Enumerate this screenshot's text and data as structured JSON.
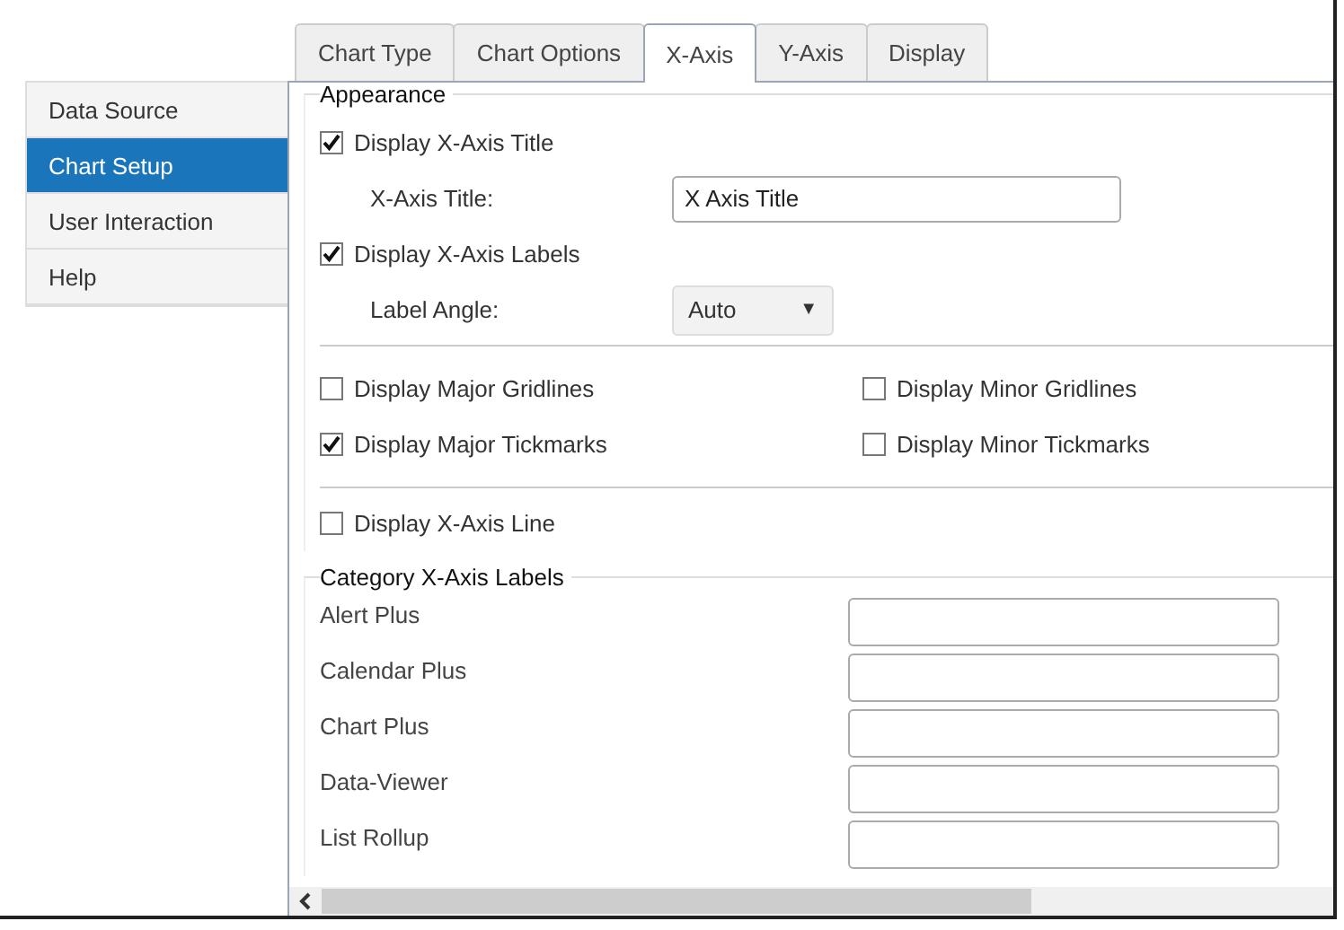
{
  "tabs": [
    {
      "label": "Chart Type",
      "selected": false
    },
    {
      "label": "Chart Options",
      "selected": false
    },
    {
      "label": "X-Axis",
      "selected": true
    },
    {
      "label": "Y-Axis",
      "selected": false
    },
    {
      "label": "Display",
      "selected": false
    }
  ],
  "sidebar": {
    "items": [
      {
        "label": "Data Source",
        "selected": false
      },
      {
        "label": "Chart Setup",
        "selected": true
      },
      {
        "label": "User Interaction",
        "selected": false
      },
      {
        "label": "Help",
        "selected": false
      }
    ]
  },
  "appearance": {
    "legend": "Appearance",
    "display_title": {
      "label": "Display X-Axis Title",
      "checked": true
    },
    "title_field": {
      "label": "X-Axis Title:",
      "value": "X Axis Title"
    },
    "display_labels": {
      "label": "Display X-Axis Labels",
      "checked": true
    },
    "label_angle": {
      "label": "Label Angle:",
      "value": "Auto",
      "caret": "▼"
    },
    "gridlines": [
      {
        "label": "Display Major Gridlines",
        "checked": false
      },
      {
        "label": "Display Minor Gridlines",
        "checked": false
      },
      {
        "label": "Display Major Tickmarks",
        "checked": true
      },
      {
        "label": "Display Minor Tickmarks",
        "checked": false
      }
    ],
    "axis_line": {
      "label": "Display X-Axis Line",
      "checked": false
    }
  },
  "category_labels": {
    "legend": "Category X-Axis Labels",
    "rows": [
      {
        "label": "Alert Plus"
      },
      {
        "label": "Calendar Plus"
      },
      {
        "label": "Chart Plus"
      },
      {
        "label": "Data-Viewer"
      },
      {
        "label": "List Rollup"
      }
    ]
  }
}
